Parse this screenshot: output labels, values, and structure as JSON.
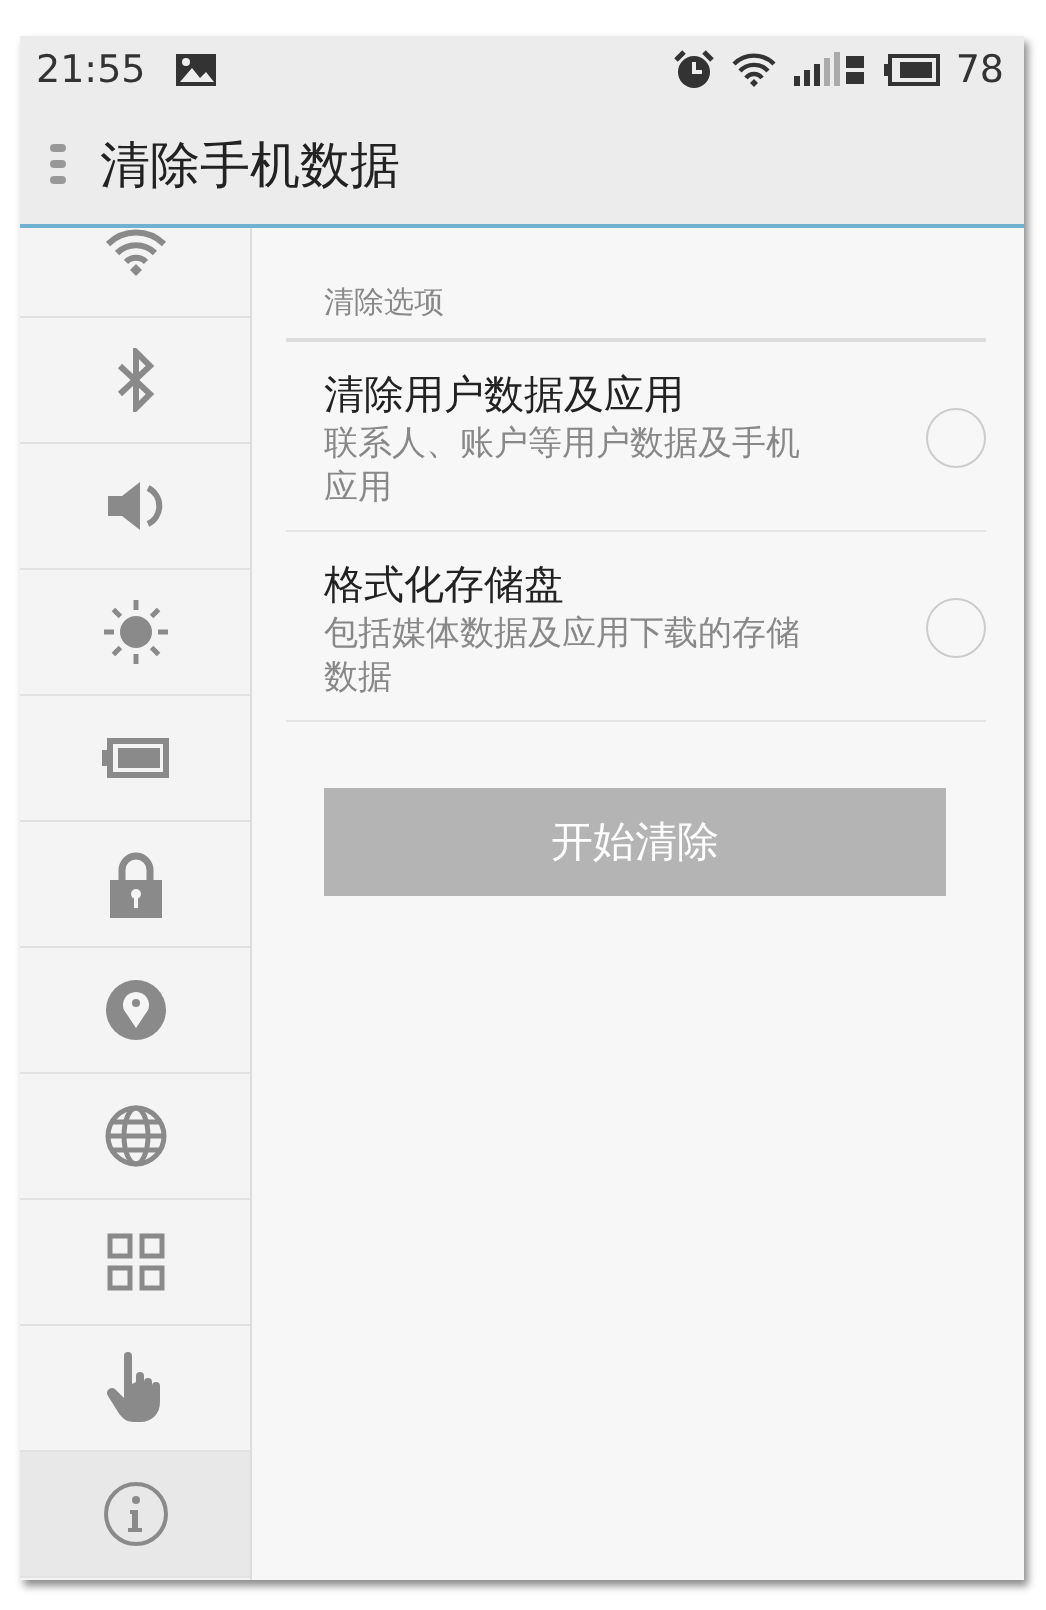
{
  "status_bar": {
    "time": "21:55",
    "battery": "78"
  },
  "header": {
    "title": "清除手机数据"
  },
  "sidebar": {
    "items": [
      {
        "kind": "wifi",
        "selected": false
      },
      {
        "kind": "bluetooth",
        "selected": false
      },
      {
        "kind": "sound",
        "selected": false
      },
      {
        "kind": "brightness",
        "selected": false
      },
      {
        "kind": "battery",
        "selected": false
      },
      {
        "kind": "lock",
        "selected": false
      },
      {
        "kind": "location",
        "selected": false
      },
      {
        "kind": "globe",
        "selected": false
      },
      {
        "kind": "apps",
        "selected": false
      },
      {
        "kind": "gesture",
        "selected": false
      },
      {
        "kind": "info",
        "selected": true
      }
    ]
  },
  "section": {
    "title": "清除选项"
  },
  "options": [
    {
      "title": "清除用户数据及应用",
      "description": "联系人、账户等用户数据及手机应用",
      "checked": false
    },
    {
      "title": "格式化存储盘",
      "description": "包括媒体数据及应用下载的存储数据",
      "checked": false
    }
  ],
  "action_button": {
    "label": "开始清除",
    "disabled": true
  }
}
